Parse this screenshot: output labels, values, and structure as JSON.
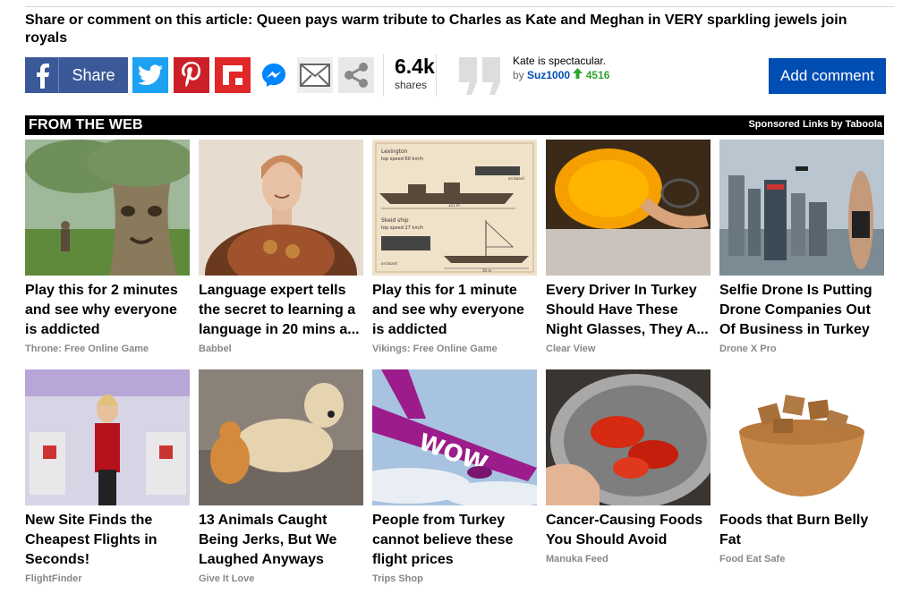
{
  "article": {
    "share_title": "Share or comment on this article: Queen pays warm tribute to Charles as Kate and Meghan in VERY sparkling jewels join royals"
  },
  "share": {
    "facebook_label": "Share",
    "count": "6.4k",
    "count_label": "shares"
  },
  "comment": {
    "text": "Kate is spectacular.",
    "by": "by",
    "user": "Suz1000",
    "score": "4516",
    "add_label": "Add comment"
  },
  "from_web": {
    "title": "FROM THE WEB",
    "sponsored": "Sponsored Links by Taboola",
    "cards": [
      {
        "title": "Play this for 2 minutes and see why everyone is addicted",
        "source": "Throne: Free Online Game"
      },
      {
        "title": "Language expert tells the secret to learning a language in 20 mins a...",
        "source": "Babbel"
      },
      {
        "title": "Play this for 1 minute and see why everyone is addicted",
        "source": "Vikings: Free Online Game"
      },
      {
        "title": "Every Driver In Turkey Should Have These Night Glasses, They A...",
        "source": "Clear View"
      },
      {
        "title": "Selfie Drone Is Putting Drone Companies Out Of Business in Turkey",
        "source": "Drone X Pro"
      },
      {
        "title": "New Site Finds the Cheapest Flights in Seconds!",
        "source": "FlightFinder"
      },
      {
        "title": "13 Animals Caught Being Jerks, But We Laughed Anyways",
        "source": "Give It Love"
      },
      {
        "title": "People from Turkey cannot believe these flight prices",
        "source": "Trips Shop"
      },
      {
        "title": "Cancer-Causing Foods You Should Avoid",
        "source": "Manuka Feed"
      },
      {
        "title": "Foods that Burn Belly Fat",
        "source": "Food Eat Safe"
      }
    ]
  },
  "ship_infographic": {
    "ship1": "Lexington",
    "ship1_speed": "top speed 60 km/h",
    "ship2": "Skeid ship",
    "ship2_speed": "top speed 27 km/h",
    "len1": "321 m",
    "len2": "30 m",
    "on_board": "on board"
  },
  "plane_livery": "WOW",
  "colors": {
    "facebook": "#3b5998",
    "twitter": "#1da1f2",
    "pinterest": "#cb2027",
    "flipboard": "#e12828",
    "add_comment": "#004db3",
    "score_green": "#2fa52f"
  }
}
